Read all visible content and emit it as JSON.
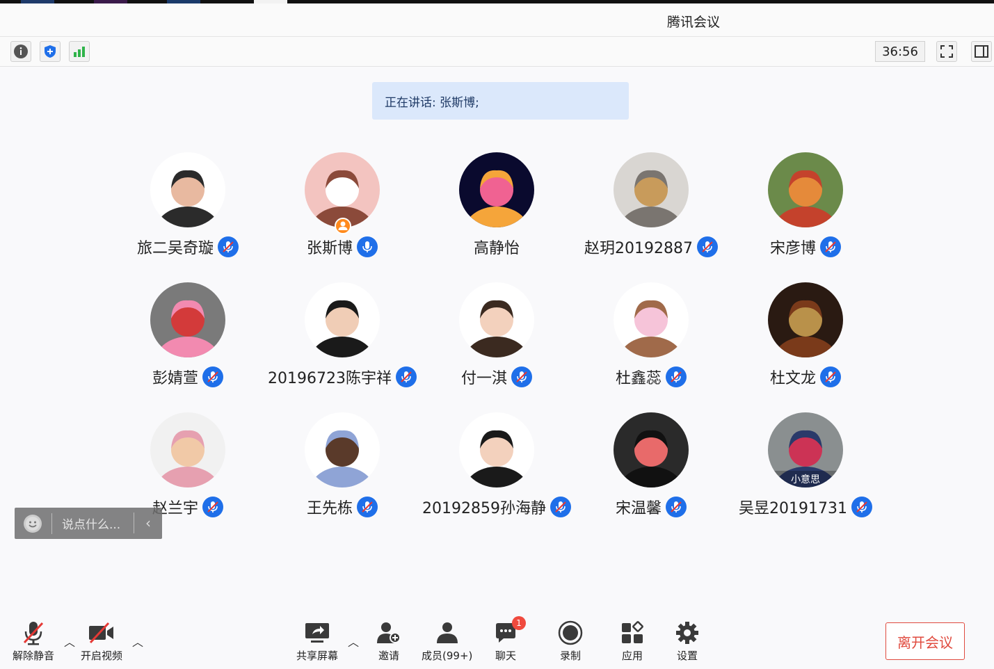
{
  "window": {
    "title": "腾讯会议"
  },
  "toolbar": {
    "timer": "36:56"
  },
  "speaking": {
    "text": "正在讲话: 张斯博;"
  },
  "participants": [
    {
      "name": "旅二吴奇璇",
      "muted": true,
      "avatar_colors": [
        "#ffffff",
        "#2b2b2b",
        "#e8b9a0"
      ]
    },
    {
      "name": "张斯博",
      "muted": false,
      "host": true,
      "avatar_colors": [
        "#f3c4c0",
        "#8b4a3a",
        "#ffffff"
      ]
    },
    {
      "name": "高静怡",
      "muted": null,
      "avatar_colors": [
        "#0a0a2e",
        "#f5a53a",
        "#f06292"
      ]
    },
    {
      "name": "赵玥20192887",
      "muted": true,
      "avatar_colors": [
        "#d9d6d2",
        "#7a7570",
        "#c89b5b"
      ]
    },
    {
      "name": "宋彦博",
      "muted": true,
      "avatar_colors": [
        "#6b8a4a",
        "#c4422c",
        "#e58a3a"
      ]
    },
    {
      "name": "彭婧萱",
      "muted": true,
      "avatar_colors": [
        "#7a7a7a",
        "#f28ab0",
        "#d33a3a"
      ]
    },
    {
      "name": "20196723陈宇祥",
      "muted": true,
      "avatar_colors": [
        "#ffffff",
        "#1a1a1a",
        "#f0cdb6"
      ]
    },
    {
      "name": "付一淇",
      "muted": true,
      "avatar_colors": [
        "#ffffff",
        "#3b2a20",
        "#f3d1bd"
      ]
    },
    {
      "name": "杜鑫蕊",
      "muted": true,
      "avatar_colors": [
        "#ffffff",
        "#a06a4a",
        "#f6c4d9"
      ]
    },
    {
      "name": "杜文龙",
      "muted": true,
      "avatar_colors": [
        "#2a1a12",
        "#7a3a1a",
        "#b9914a"
      ]
    },
    {
      "name": "赵兰宇",
      "muted": true,
      "avatar_colors": [
        "#f1f1f1",
        "#e6a0b0",
        "#f1c9a7"
      ]
    },
    {
      "name": "王先栋",
      "muted": true,
      "avatar_colors": [
        "#ffffff",
        "#8fa4d6",
        "#5a3a2a"
      ]
    },
    {
      "name": "20192859孙海静",
      "muted": true,
      "avatar_colors": [
        "#ffffff",
        "#1a1a1a",
        "#f3d1bd"
      ]
    },
    {
      "name": "宋温馨",
      "muted": true,
      "avatar_colors": [
        "#2a2a2a",
        "#111111",
        "#e86a6a"
      ]
    },
    {
      "name": "吴昱20191731",
      "muted": true,
      "avatar_colors": [
        "#8a8f90",
        "#2a3a6a",
        "#cc3355"
      ],
      "overlay": "小意思"
    }
  ],
  "chat": {
    "placeholder": "说点什么..."
  },
  "bottom": {
    "unmute": "解除静音",
    "video": "开启视频",
    "share": "共享屏幕",
    "invite": "邀请",
    "members": "成员(99+)",
    "chat": "聊天",
    "chat_badge": "1",
    "record": "录制",
    "apps": "应用",
    "settings": "设置",
    "leave": "离开会议"
  },
  "colors": {
    "accent": "#1f6fe9",
    "danger": "#e04a3e",
    "speaking_bg": "#dbe8fb"
  }
}
